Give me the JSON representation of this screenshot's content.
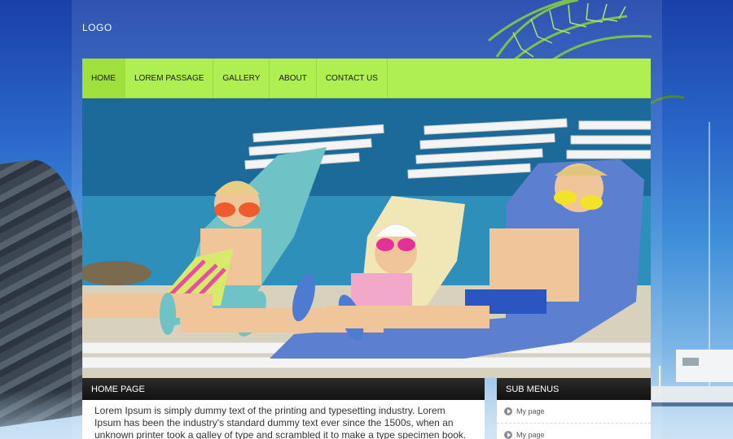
{
  "header": {
    "logo_text": "LOGO"
  },
  "nav": {
    "items": [
      {
        "label": "HOME",
        "active": true
      },
      {
        "label": "LOREM PASSAGE",
        "active": false
      },
      {
        "label": "GALLERY",
        "active": false
      },
      {
        "label": "ABOUT",
        "active": false
      },
      {
        "label": "CONTACT US",
        "active": false
      }
    ]
  },
  "main": {
    "title": "HOME PAGE",
    "body": "Lorem Ipsum is simply dummy text of the printing and typesetting industry. Lorem Ipsum has been the industry's standard dummy text ever since the 1500s, when an unknown printer took a galley of type and scrambled it to make a type specimen book."
  },
  "sidebar": {
    "title": "SUB MENUS",
    "items": [
      {
        "label": "My page"
      },
      {
        "label": "My page"
      }
    ]
  },
  "colors": {
    "nav_bg": "#b0ef52",
    "nav_active": "#9fe03c",
    "panel_header": "#111111"
  }
}
